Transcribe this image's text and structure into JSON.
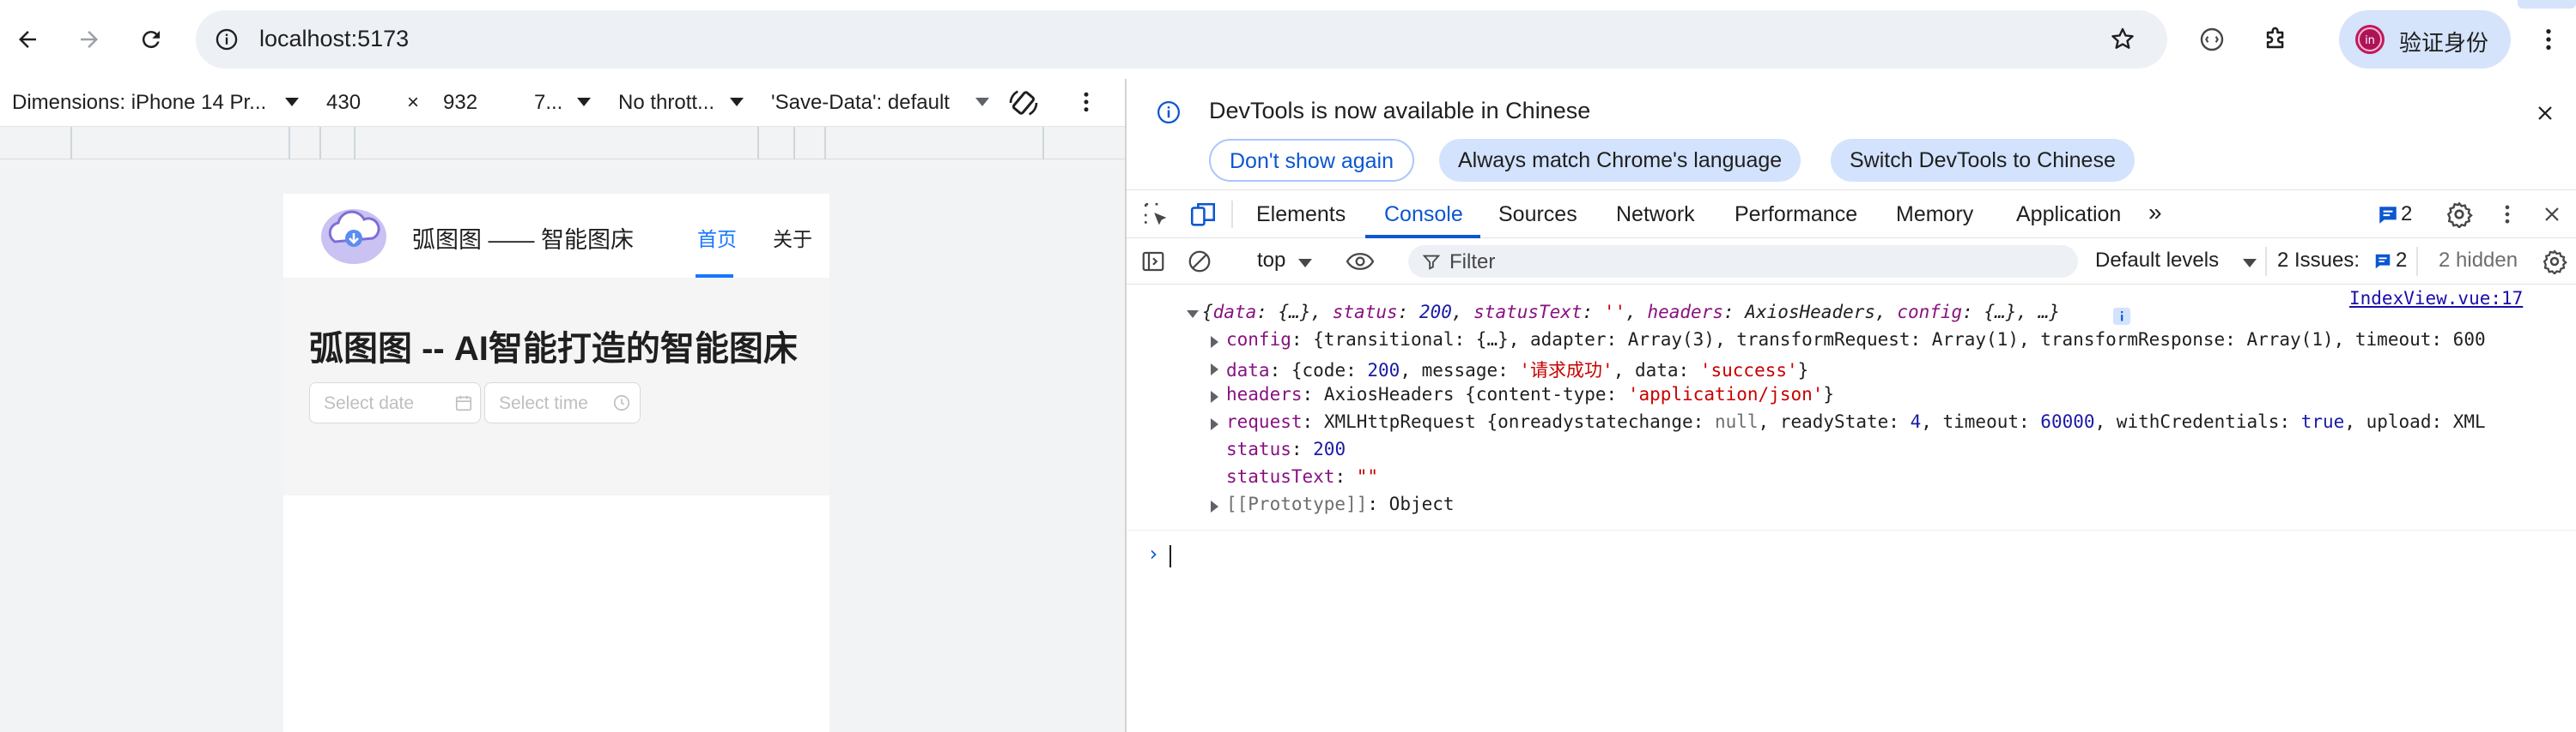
{
  "browser": {
    "url": "localhost:5173",
    "profile_label": "验证身份",
    "profile_initial": "in"
  },
  "device_toolbar": {
    "dimensions": "Dimensions: iPhone 14 Pr...",
    "width": "430",
    "times": "×",
    "height": "932",
    "zoom": "7...",
    "throttle": "No thrott...",
    "save_data": "'Save-Data': default"
  },
  "site": {
    "title": "弧图图 —— 智能图床",
    "nav": [
      {
        "label": "首页",
        "active": true
      },
      {
        "label": "关于",
        "active": false
      }
    ],
    "heading": "弧图图 -- AI智能打造的智能图床",
    "date_placeholder": "Select date",
    "time_placeholder": "Select time"
  },
  "devtools": {
    "info_message": "DevTools is now available in Chinese",
    "info_buttons": {
      "dont_show": "Don't show again",
      "match": "Always match Chrome's language",
      "switch": "Switch DevTools to Chinese"
    },
    "tabs": [
      "Elements",
      "Console",
      "Sources",
      "Network",
      "Performance",
      "Memory",
      "Application"
    ],
    "active_tab": "Console",
    "issues_badge": "2",
    "console_toolbar": {
      "context": "top",
      "filter_placeholder": "Filter",
      "levels": "Default levels",
      "issues_label": "2 Issues:",
      "issues_count": "2",
      "hidden": "2 hidden"
    },
    "console": {
      "source_link": "IndexView.vue:17",
      "summary": {
        "open": "{",
        "data_key": "data",
        "data_val": "{…}",
        "status_key": "status",
        "status_val": "200",
        "statusText_key": "statusText",
        "statusText_val": "''",
        "headers_key": "headers",
        "headers_val": "AxiosHeaders",
        "config_key": "config",
        "config_val": "{…}",
        "close": "…}"
      },
      "config_line": {
        "key": "config",
        "rest": "{transitional: {…}, adapter: Array(3), transformRequest: Array(1), transformResponse: Array(1), timeout: 600"
      },
      "data_line": {
        "key": "data",
        "pre": "{code: ",
        "code": "200",
        "mid": ", message: ",
        "message": "'请求成功'",
        "mid2": ", data: ",
        "data": "'success'",
        "post": "}"
      },
      "headers_line": {
        "key": "headers",
        "pre": "AxiosHeaders {content-type: ",
        "ct": "'application/json'",
        "post": "}"
      },
      "request_line": {
        "key": "request",
        "pre": "XMLHttpRequest {onreadystatechange: ",
        "null": "null",
        "mid": ", readyState: ",
        "rs": "4",
        "mid2": ", timeout: ",
        "to": "60000",
        "mid3": ", withCredentials: ",
        "wc": "true",
        "post": ", upload: XML"
      },
      "status_line": {
        "key": "status",
        "value": "200"
      },
      "statusText_line": {
        "key": "statusText",
        "value": "\"\""
      },
      "prototype_line": {
        "key": "[[Prototype]]",
        "value": "Object"
      },
      "prompt": "›"
    }
  },
  "colors": {
    "accent_blue": "#1677ff",
    "devtools_blue": "#0b57d0",
    "console_key": "#881280",
    "console_string": "#c80000",
    "console_number": "#1a1aa6"
  }
}
